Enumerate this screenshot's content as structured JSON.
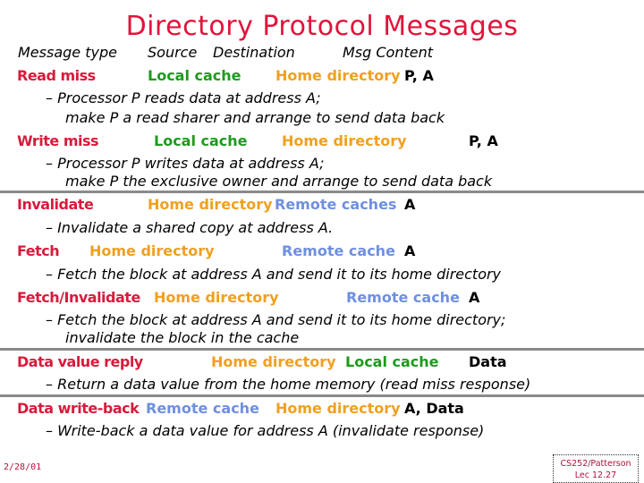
{
  "title": "Directory Protocol Messages",
  "header": {
    "message_type": "Message type",
    "source": "Source",
    "destination": "Destination",
    "msg_content": "Msg Content"
  },
  "colors": {
    "title": "#e0143c",
    "message_type": "#d81b3c",
    "local_cache": "#1e9a1e",
    "home_directory": "#f0a020",
    "remote_cache": "#6f8fe0"
  },
  "messages": [
    {
      "type": "Read miss",
      "source": "Local cache",
      "destination": "Home directory",
      "content": "P, A",
      "desc": [
        "– Processor P reads data at address A;",
        "make P a read sharer and arrange to send data back"
      ]
    },
    {
      "type": "Write miss",
      "source": "Local cache",
      "destination": "Home directory",
      "content": "P, A",
      "desc": [
        "– Processor P writes data at address A;",
        "make P the exclusive owner and arrange to send data back"
      ]
    },
    {
      "type": "Invalidate",
      "source": "Home directory",
      "destination": "Remote caches",
      "content": "A",
      "desc": [
        "– Invalidate a shared copy at address A."
      ]
    },
    {
      "type": "Fetch",
      "source": "Home directory",
      "destination": "Remote cache",
      "content": "A",
      "desc": [
        "– Fetch the block at address A and send it to its home directory"
      ]
    },
    {
      "type": "Fetch/Invalidate",
      "source": "Home directory",
      "destination": "Remote cache",
      "content": "A",
      "desc": [
        "– Fetch the block at address A and send it to its home directory;",
        "invalidate the block in the cache"
      ]
    },
    {
      "type": "Data value reply",
      "source": "Home directory",
      "destination": "Local cache",
      "content": "Data",
      "desc": [
        "– Return a data value from the home memory (read miss response)"
      ]
    },
    {
      "type": "Data write-back",
      "source": "Remote cache",
      "destination": "Home directory",
      "content": "A, Data",
      "desc": [
        "– Write-back a data value for address A (invalidate response)"
      ]
    }
  ],
  "footer": {
    "date": "2/28/01",
    "course": "CS252/Patterson",
    "lecture": "Lec 12.27"
  }
}
